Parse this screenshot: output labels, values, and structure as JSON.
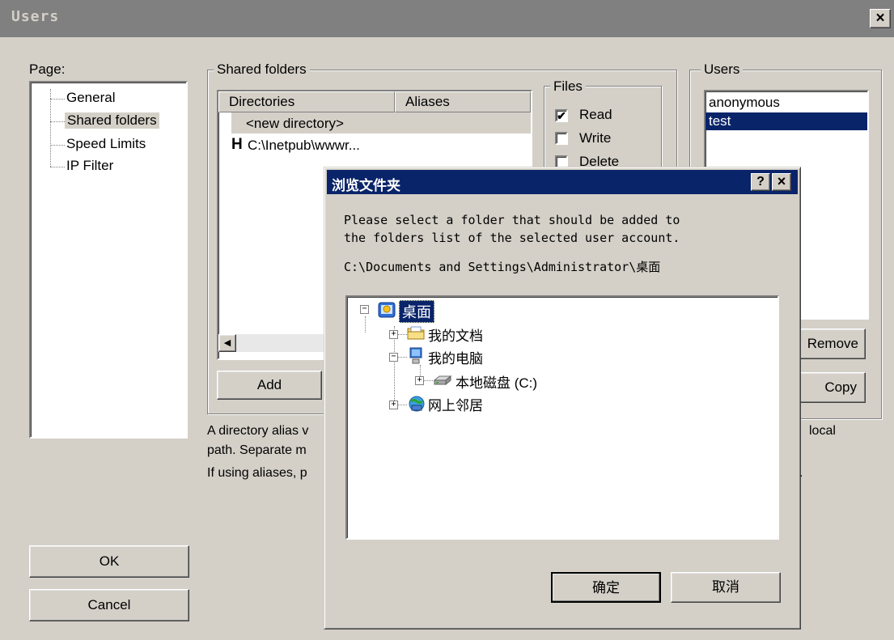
{
  "window": {
    "title": "Users",
    "close": "×"
  },
  "page_panel": {
    "label": "Page:",
    "items": [
      "General",
      "Shared folders",
      "Speed Limits",
      "IP Filter"
    ],
    "selected": "Shared folders"
  },
  "shared": {
    "group_label": "Shared folders",
    "columns": [
      "Directories",
      "Aliases"
    ],
    "rows": [
      {
        "mark": "",
        "dir": "<new directory>"
      },
      {
        "mark": "H",
        "dir": "C:\\Inetpub\\wwwr..."
      }
    ],
    "add_button": "Add",
    "files_group": "Files",
    "files": [
      {
        "label": "Read",
        "checked": true
      },
      {
        "label": "Write",
        "checked": false
      },
      {
        "label": "Delete",
        "checked": false
      }
    ]
  },
  "users_panel": {
    "group_label": "Users",
    "items": [
      "anonymous",
      "test"
    ],
    "selected": "test",
    "remove_button": "Remove",
    "copy_button": "Copy"
  },
  "help": {
    "line1_start": "A directory alias v",
    "line1_end": "local",
    "line2": "path. Separate m",
    "line3_start": "If using aliases, p",
    "line3_end": "."
  },
  "bottom": {
    "ok": "OK",
    "cancel": "Cancel"
  },
  "browse_dialog": {
    "title": "浏览文件夹",
    "help_btn": "?",
    "close_btn": "×",
    "message_line1": "Please select a folder that should be added to",
    "message_line2": "the folders list of the selected user account.",
    "path": "C:\\Documents and Settings\\Administrator\\桌面",
    "tree": {
      "root": "桌面",
      "my_docs": "我的文档",
      "my_computer": "我的电脑",
      "local_disk": "本地磁盘 (C:)",
      "network": "网上邻居"
    },
    "ok": "确定",
    "cancel": "取消",
    "icons": [
      "desktop-icon",
      "folder-icon",
      "computer-icon",
      "drive-icon",
      "network-icon"
    ]
  }
}
